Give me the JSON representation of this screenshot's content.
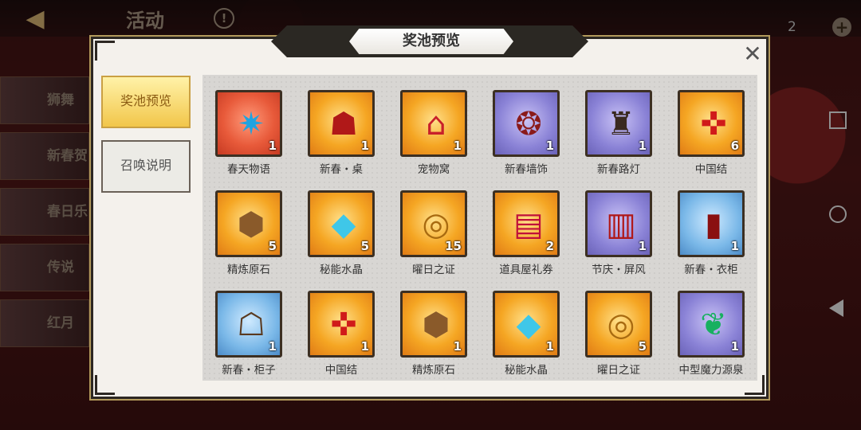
{
  "background": {
    "page_title": "活动",
    "currency_count": "2",
    "left_events": [
      "狮舞",
      "新春贺",
      "春日乐",
      "传说",
      "红月"
    ]
  },
  "modal": {
    "title": "奖池预览",
    "close_glyph": "✕",
    "tabs": [
      {
        "label": "奖池预览",
        "active": true
      },
      {
        "label": "召唤说明",
        "active": false
      }
    ],
    "items": [
      {
        "name": "春天物语",
        "qty": "1",
        "rarity": "red",
        "icon": "blue-crystal-star-icon"
      },
      {
        "name": "新春・桌",
        "qty": "1",
        "rarity": "gold",
        "icon": "lion-table-icon"
      },
      {
        "name": "宠物窝",
        "qty": "1",
        "rarity": "gold",
        "icon": "pet-bed-icon"
      },
      {
        "name": "新春墙饰",
        "qty": "1",
        "rarity": "purple",
        "icon": "wall-ornament-icon"
      },
      {
        "name": "新春路灯",
        "qty": "1",
        "rarity": "purple",
        "icon": "street-lamp-icon"
      },
      {
        "name": "中国结",
        "qty": "6",
        "rarity": "gold",
        "icon": "chinese-knot-icon"
      },
      {
        "name": "精炼原石",
        "qty": "5",
        "rarity": "gold",
        "icon": "refined-ore-icon"
      },
      {
        "name": "秘能水晶",
        "qty": "5",
        "rarity": "gold",
        "icon": "ice-crystal-icon"
      },
      {
        "name": "曜日之证",
        "qty": "15",
        "rarity": "gold",
        "icon": "sun-medal-icon"
      },
      {
        "name": "道具屋礼券",
        "qty": "2",
        "rarity": "gold",
        "icon": "shop-voucher-icon"
      },
      {
        "name": "节庆・屏风",
        "qty": "1",
        "rarity": "purple",
        "icon": "folding-screen-icon"
      },
      {
        "name": "新春・衣柜",
        "qty": "1",
        "rarity": "blue",
        "icon": "wardrobe-icon"
      },
      {
        "name": "新春・柜子",
        "qty": "1",
        "rarity": "blue",
        "icon": "cabinet-icon"
      },
      {
        "name": "中国结",
        "qty": "1",
        "rarity": "gold",
        "icon": "chinese-knot-icon"
      },
      {
        "name": "精炼原石",
        "qty": "1",
        "rarity": "gold",
        "icon": "refined-ore-icon"
      },
      {
        "name": "秘能水晶",
        "qty": "1",
        "rarity": "gold",
        "icon": "ice-crystal-icon"
      },
      {
        "name": "曜日之证",
        "qty": "5",
        "rarity": "gold",
        "icon": "sun-medal-icon"
      },
      {
        "name": "中型魔力源泉",
        "qty": "1",
        "rarity": "purple",
        "icon": "mana-fountain-icon"
      }
    ]
  }
}
